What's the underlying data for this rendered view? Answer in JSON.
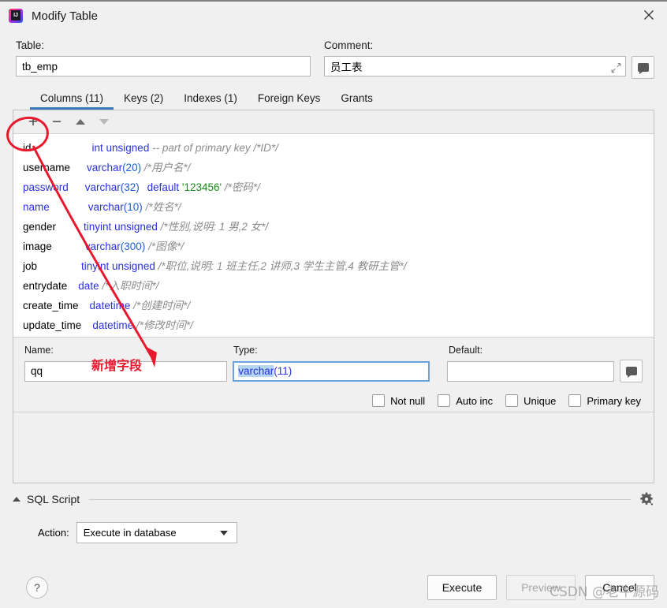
{
  "window": {
    "title": "Modify Table",
    "app_icon": "intellij-idea-icon",
    "close_icon": "close-icon"
  },
  "form": {
    "table_label": "Table:",
    "table_value": "tb_emp",
    "comment_label": "Comment:",
    "comment_value": "员工表",
    "expand_icon": "expand-icon",
    "comment_button_icon": "speech-bubble-icon"
  },
  "tabs": [
    {
      "label": "Columns (11)",
      "active": true
    },
    {
      "label": "Keys (2)",
      "active": false
    },
    {
      "label": "Indexes (1)",
      "active": false
    },
    {
      "label": "Foreign Keys",
      "active": false
    },
    {
      "label": "Grants",
      "active": false
    }
  ],
  "toolbar": {
    "add_icon": "plus-icon",
    "remove_icon": "minus-icon",
    "move_up_icon": "triangle-up-icon",
    "move_down_icon": "triangle-down-icon"
  },
  "columns": [
    {
      "name": "id",
      "keyword": false,
      "pad": 9,
      "type": "int unsigned",
      "extra": "",
      "default": "",
      "comment": "-- part of primary key /*ID*/"
    },
    {
      "name": "username",
      "keyword": false,
      "pad": 1,
      "type": "varchar",
      "size": "(20)",
      "extra": "",
      "default": "",
      "comment": "/*用户名*/"
    },
    {
      "name": "password",
      "keyword": true,
      "pad": 1,
      "type": "varchar",
      "size": "(32)",
      "extra": "default",
      "default": "'123456'",
      "comment": "/*密码*/"
    },
    {
      "name": "name",
      "keyword": true,
      "pad": 5,
      "type": "varchar",
      "size": "(10)",
      "extra": "",
      "default": "",
      "comment": "/*姓名*/"
    },
    {
      "name": "gender",
      "keyword": false,
      "pad": 3,
      "type": "tinyint unsigned",
      "extra": "",
      "default": "",
      "comment": "/*性别,说明: 1 男,2 女*/"
    },
    {
      "name": "image",
      "keyword": false,
      "pad": 4,
      "type": "varchar",
      "size": "(300)",
      "extra": "",
      "default": "",
      "comment": "/*图像*/"
    },
    {
      "name": "job",
      "keyword": false,
      "pad": 6,
      "type": "tinyint unsigned",
      "extra": "",
      "default": "",
      "comment": "/*职位,说明: 1 班主任,2 讲师,3 学生主管,4 教研主管*/"
    },
    {
      "name": "entrydate",
      "keyword": false,
      "pad": 0,
      "type": "date",
      "extra": "",
      "default": "",
      "comment": "/*入职时间*/"
    },
    {
      "name": "create_time",
      "keyword": false,
      "pad": 0,
      "type": "datetime",
      "extra": "",
      "default": "",
      "comment": "/*创建时间*/"
    },
    {
      "name": "update_time",
      "keyword": false,
      "pad": 0,
      "type": "datetime",
      "extra": "",
      "default": "",
      "comment": "/*修改时间*/"
    }
  ],
  "editor": {
    "name_label": "Name:",
    "name_value": "qq",
    "type_label": "Type:",
    "type_value_selected": "varchar",
    "type_value_rest": "(11)",
    "default_label": "Default:",
    "default_value": "",
    "default_button_icon": "speech-bubble-icon",
    "checkboxes": [
      {
        "label": "Not null",
        "checked": false
      },
      {
        "label": "Auto inc",
        "checked": false
      },
      {
        "label": "Unique",
        "checked": false
      },
      {
        "label": "Primary key",
        "checked": false
      }
    ]
  },
  "sql_section": {
    "collapse_icon": "caret-up-icon",
    "title": "SQL Script",
    "settings_icon": "gear-icon",
    "action_label": "Action:",
    "action_value": "Execute in database",
    "action_options": [
      "Execute in database"
    ]
  },
  "footer": {
    "help_label": "?",
    "help_icon": "help-icon",
    "buttons": [
      {
        "label": "Execute",
        "disabled": false
      },
      {
        "label": "Preview",
        "disabled": true
      },
      {
        "label": "Cancel",
        "disabled": false
      }
    ]
  },
  "annotations": {
    "new_field_text": "新增字段",
    "highlight_color": "#e8192c",
    "circle_target": "add-column-button"
  },
  "watermark": "CSDN @老牛源码",
  "colors": {
    "accent_tab": "#3d7ab8",
    "keyword": "#2a30e0",
    "string": "#1a8a1a",
    "comment": "#8c8c8c",
    "annotation": "#e8192c",
    "window_bg": "#f0f0f0"
  }
}
